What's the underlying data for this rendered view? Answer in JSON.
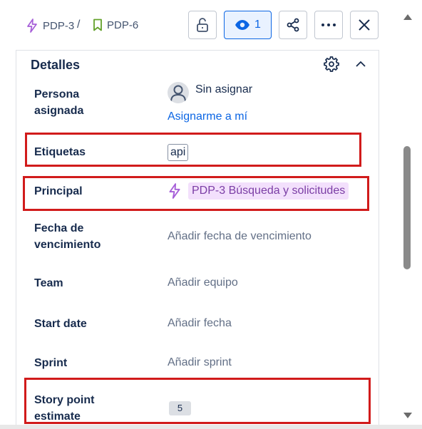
{
  "breadcrumb": {
    "parent": "PDP-3",
    "separator": "/",
    "current": "PDP-6"
  },
  "toolbar": {
    "watch_count": "1",
    "icons": [
      "unlock-icon",
      "eye-icon",
      "share-icon",
      "more-icon",
      "close-icon"
    ]
  },
  "details": {
    "title": "Detalles",
    "fields": {
      "assignee": {
        "label_line1": "Persona",
        "label_line2": "asignada",
        "value": "Sin asignar",
        "action": "Asignarme a mí"
      },
      "labels": {
        "label": "Etiquetas",
        "value": "api"
      },
      "parent": {
        "label": "Principal",
        "value": "PDP-3 Búsqueda y solicitudes"
      },
      "due_date": {
        "label_line1": "Fecha de",
        "label_line2": "vencimiento",
        "value": "Añadir fecha de vencimiento"
      },
      "team": {
        "label": "Team",
        "value": "Añadir equipo"
      },
      "start_date": {
        "label": "Start date",
        "value": "Añadir fecha"
      },
      "sprint": {
        "label": "Sprint",
        "value": "Añadir sprint"
      },
      "story_points": {
        "label_line1": "Story point",
        "label_line2": "estimate",
        "value": "5"
      }
    }
  },
  "colors": {
    "epic_purple": "#a65fd8",
    "story_green": "#63a12a",
    "link_blue": "#0c66e4",
    "highlight_red": "#d11b1b"
  }
}
